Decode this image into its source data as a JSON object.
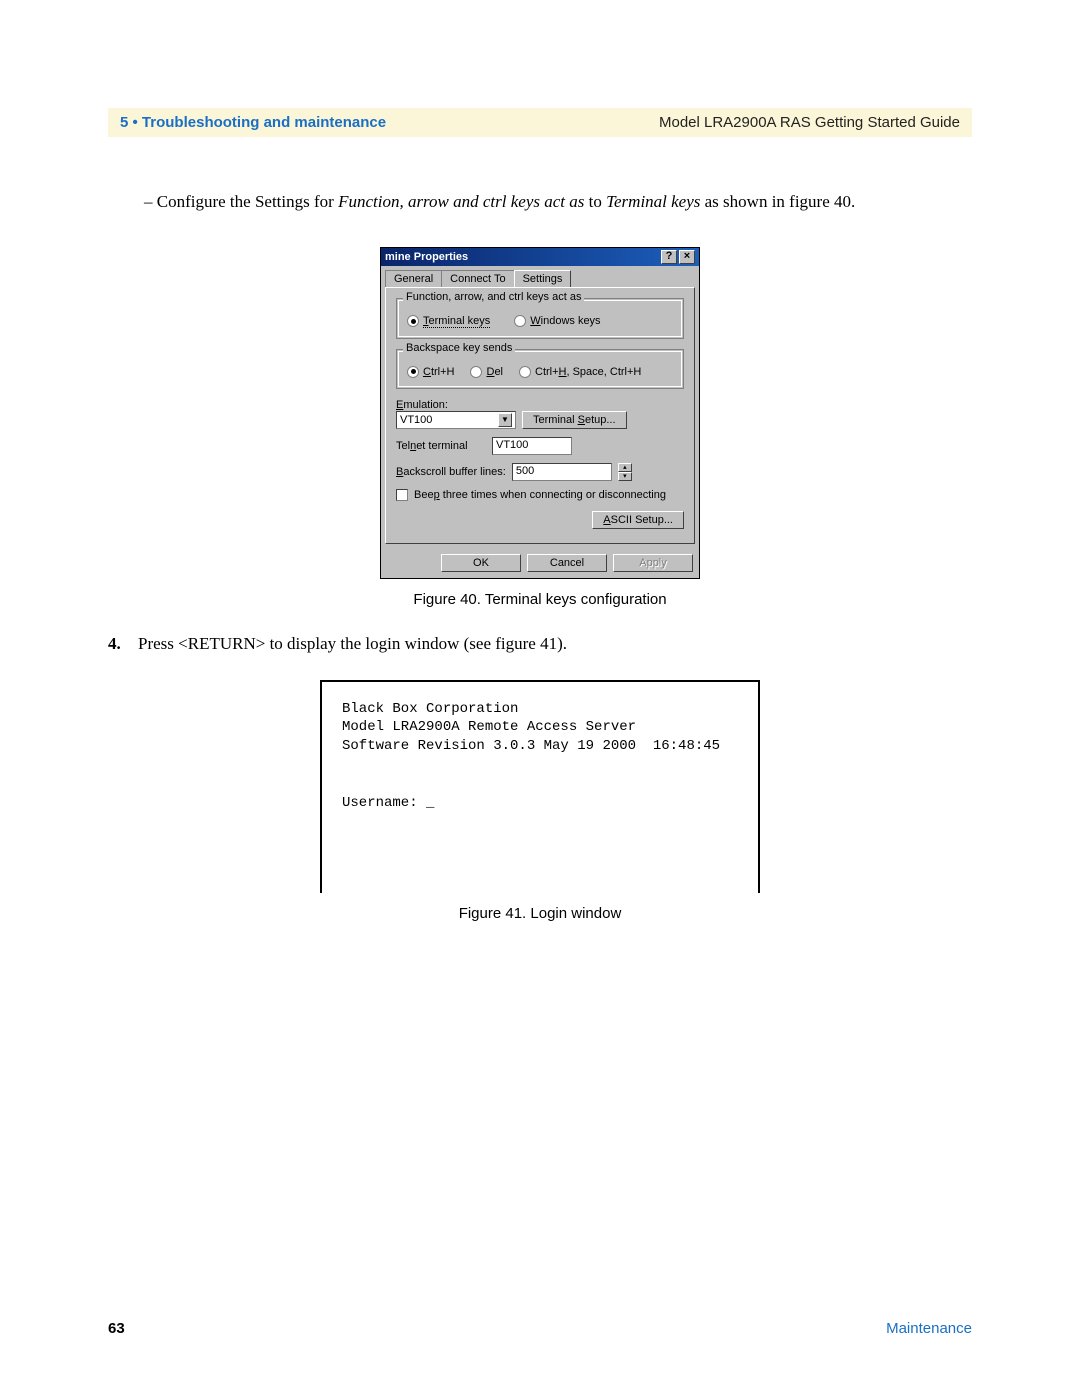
{
  "header": {
    "chapter": "5 • Troubleshooting and maintenance",
    "guide": "Model LRA2900A RAS Getting Started Guide"
  },
  "intro": {
    "prefix": "– Configure the Settings for ",
    "italic1": "Function, arrow and ctrl keys act as",
    "mid": " to ",
    "italic2": "Terminal keys",
    "suffix": " as shown in figure 40."
  },
  "dialog": {
    "title": "mine Properties",
    "help": "?",
    "close": "×",
    "tabs": {
      "general": "General",
      "connect": "Connect To",
      "settings": "Settings"
    },
    "group1": {
      "title": "Function, arrow, and ctrl keys act as",
      "opt1": "Terminal keys",
      "opt2": "Windows keys"
    },
    "group2": {
      "title": "Backspace key sends",
      "opt1": "Ctrl+H",
      "opt2": "Del",
      "opt3": "Ctrl+H, Space, Ctrl+H"
    },
    "emu_label": "Emulation:",
    "emu_value": "VT100",
    "term_setup": "Terminal Setup...",
    "telnet_label": "Telnet terminal",
    "telnet_value": "VT100",
    "back_label": "Backscroll buffer lines:",
    "back_value": "500",
    "beep": "Beep three times when connecting or disconnecting",
    "ascii": "ASCII Setup...",
    "ok": "OK",
    "cancel": "Cancel",
    "apply": "Apply"
  },
  "caption40": "Figure 40. Terminal keys configuration",
  "step4": {
    "num": "4.",
    "text": "Press <RETURN> to display the login window (see figure 41)."
  },
  "terminal": {
    "line1": "Black Box Corporation",
    "line2": "Model LRA2900A Remote Access Server",
    "line3": "Software Revision 3.0.3 May 19 2000  16:48:45",
    "prompt": "Username: _"
  },
  "caption41": "Figure 41. Login window",
  "footer": {
    "page": "63",
    "section": "Maintenance"
  }
}
